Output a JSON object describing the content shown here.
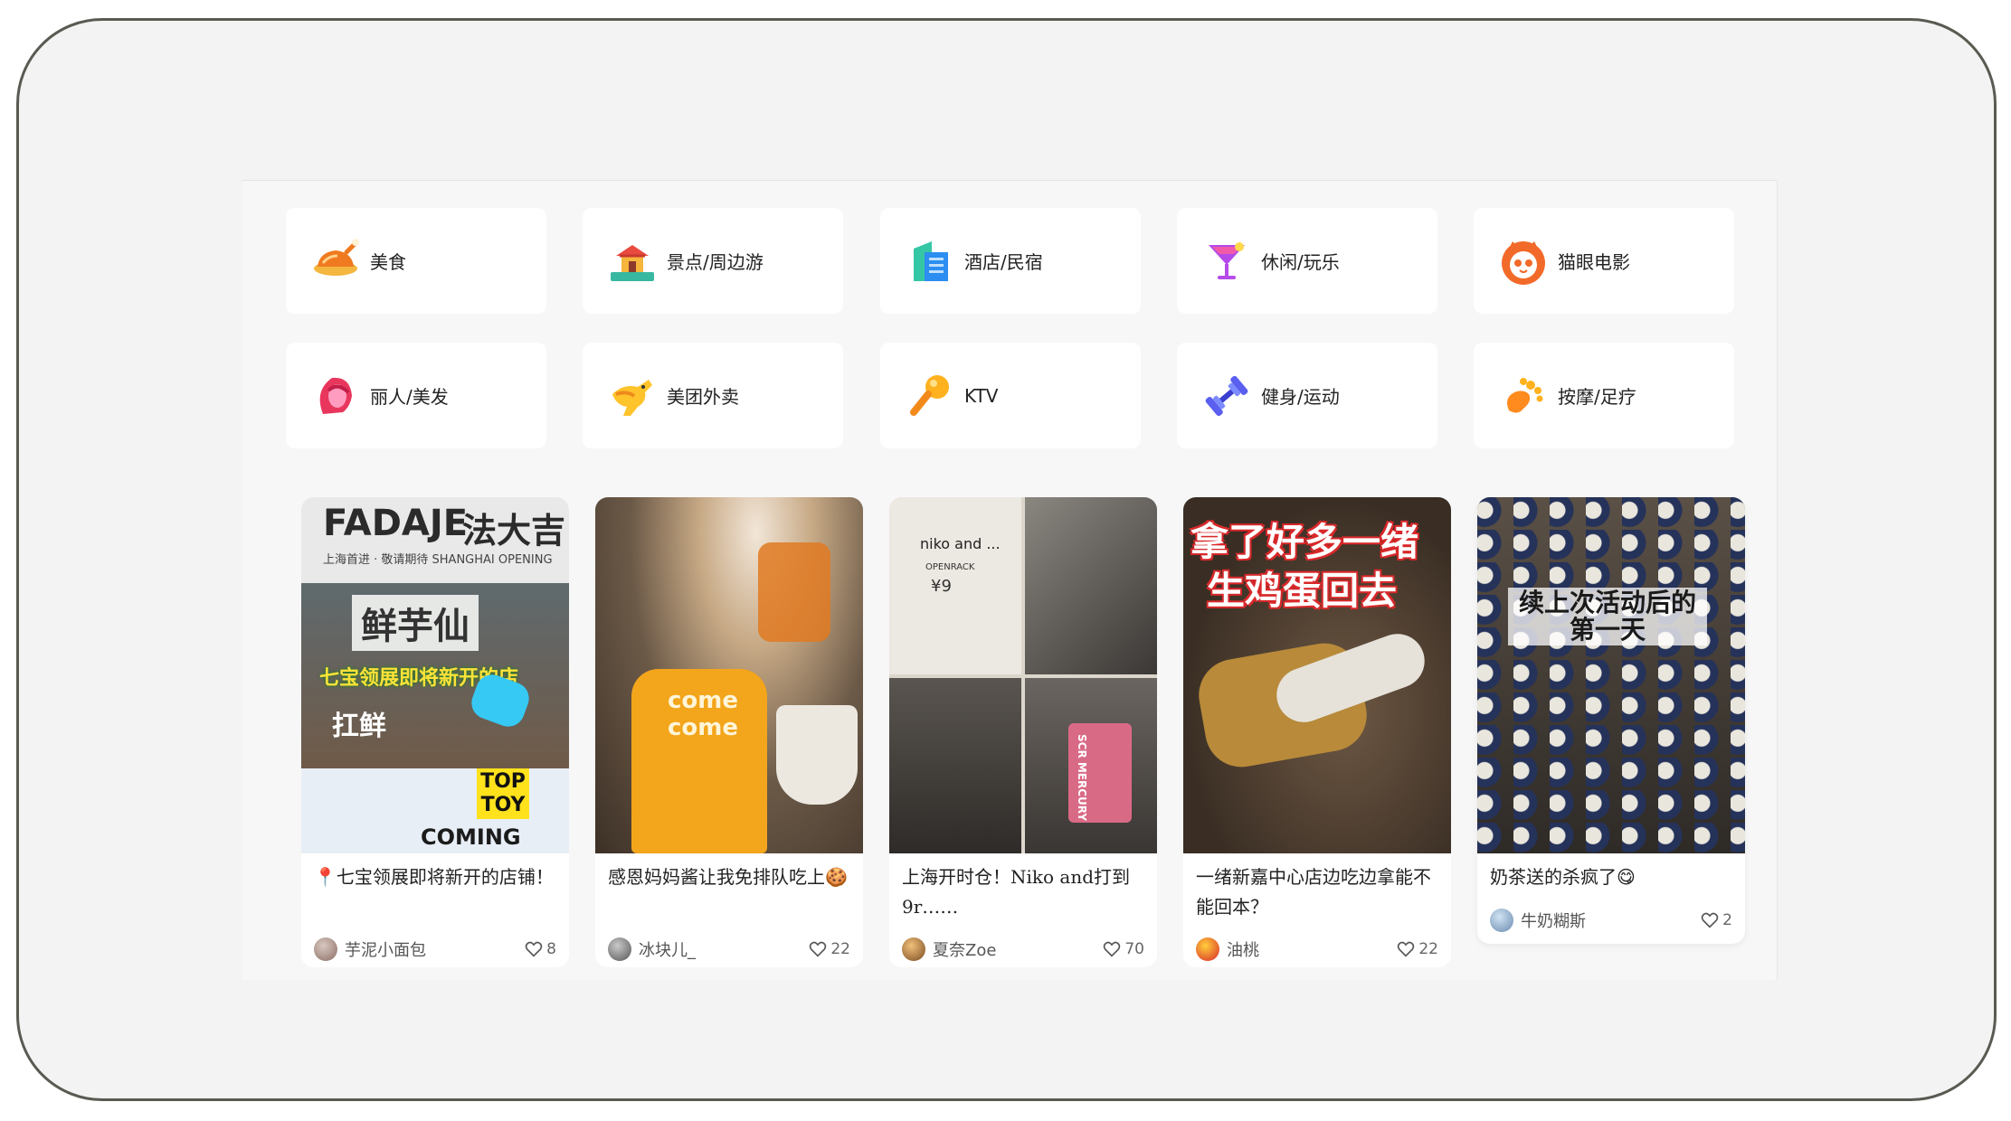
{
  "categories": [
    {
      "label": "美食",
      "icon": "roast-chicken-icon"
    },
    {
      "label": "景点/周边游",
      "icon": "pagoda-icon"
    },
    {
      "label": "酒店/民宿",
      "icon": "hotel-building-icon"
    },
    {
      "label": "休闲/玩乐",
      "icon": "cocktail-icon"
    },
    {
      "label": "猫眼电影",
      "icon": "maoyan-cat-icon"
    },
    {
      "label": "丽人/美发",
      "icon": "woman-hair-icon"
    },
    {
      "label": "美团外卖",
      "icon": "kangaroo-icon"
    },
    {
      "label": "KTV",
      "icon": "microphone-icon"
    },
    {
      "label": "健身/运动",
      "icon": "dumbbell-icon"
    },
    {
      "label": "按摩/足疗",
      "icon": "foot-icon"
    }
  ],
  "feed": [
    {
      "title": "📍七宝领展即将新开的店铺！",
      "author": "芋泥小面包",
      "likes": "8",
      "overlay": {
        "brand_en": "FADAJE",
        "brand_cn": "法大吉",
        "sub": "上海首进 · 敬请期待 SHANGHAI OPENING",
        "shop": "鲜芋仙",
        "caption": "七宝领展即将新开的店",
        "shop2": "扛鲜",
        "toy": "TOP TOY",
        "coming": "COMING SOON"
      }
    },
    {
      "title": "感恩妈妈酱让我免排队吃上🍪",
      "author": "冰块儿_",
      "likes": "22",
      "overlay": {
        "bread": "come come"
      }
    },
    {
      "title": "上海开时仓！Niko and打到9r……",
      "author": "夏奈Zoe",
      "likes": "70",
      "overlay": {
        "brand": "niko and ...",
        "tag": "OPENRACK",
        "price": "¥9",
        "bag": "SCR MERCURY"
      }
    },
    {
      "title": "一绪新嘉中心店边吃边拿能不能回本？",
      "author": "油桃",
      "likes": "22",
      "overlay": {
        "headline1": "拿了好多一绪",
        "headline2": "生鸡蛋回去"
      }
    },
    {
      "title": "奶茶送的杀疯了😋",
      "author": "牛奶糊斯",
      "likes": "2",
      "overlay": {
        "headline1": "续上次活动后的",
        "headline2": "第一天"
      }
    }
  ]
}
